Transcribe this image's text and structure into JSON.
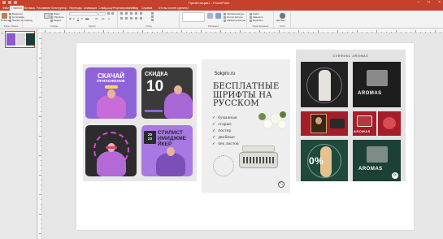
{
  "window": {
    "title": "Презентация1 - PowerPoint",
    "title_short": "Презентация1 - PowerPoint"
  },
  "ribbon": {
    "tabs": [
      "Файл",
      "Главная",
      "Вставка",
      "Рисование",
      "Конструктор",
      "Переходы",
      "Анимация",
      "Слайд-шоу",
      "Рецензирование",
      "Вид",
      "Справка",
      "Что вы хотите сделать?"
    ],
    "active_tab_index": 1,
    "groups": {
      "clipboard": {
        "label": "Буфер обмена",
        "paste": "Вставить",
        "cut": "Вырезать",
        "copy": "Копировать",
        "format": "Формат по образцу"
      },
      "slides": {
        "label": "Слайды",
        "new_slide": "Создать слайд",
        "layout": "Макет",
        "reset": "Сбросить",
        "section": "Раздел"
      },
      "font": {
        "label": "Шрифт",
        "name": "",
        "size": ""
      },
      "paragraph": {
        "label": "Абзац"
      },
      "drawing": {
        "label": "Рисование",
        "arrange": "Упорядочить",
        "quick_styles": "Экспресс-стили",
        "fill": "Заливка фигуры",
        "outline": "Контур фигуры",
        "effects": "Эффекты фигуры"
      },
      "editing": {
        "label": "Редактирование",
        "find": "Найти",
        "replace": "Заменить",
        "select": "Выделить"
      },
      "dictate": {
        "label": "Голос",
        "button": "Диктовать"
      }
    }
  },
  "slide_pane": {
    "slide_number": "1"
  },
  "slide": {
    "collage": {
      "card1_line1": "СКАЧАЙ",
      "card1_line2": "ПРИЛОЖЕНИЕ",
      "card2_title": "СКИДКА",
      "card2_number": "10",
      "card4_line1": "СТИЛИСТ",
      "card4_line2": "ИМИДЖМЕ",
      "card4_line3": "ЙКЕР",
      "card4_year": "20\n23"
    },
    "middle": {
      "url": "5okpro.ru",
      "headline": "БЕСПЛАТНЫЕ ШРИФТЫ НА РУССКОМ",
      "features": [
        "бумажная",
        "старые",
        "постер",
        "двойные",
        "чек листов"
      ]
    },
    "right": {
      "header": "СУФФИКС AROMAS",
      "aroma1": "AROMAS",
      "aroma2": "AROMAS",
      "aroma3": "AROMAS",
      "aroma4": "AROMAS",
      "aroma_bottom": "AROMAS",
      "discount": "0%"
    }
  },
  "colors": {
    "titlebar": "#c4412b",
    "purple": "#8a5ad0",
    "dark_green": "#1c3d34",
    "crimson": "#a61d2a"
  }
}
